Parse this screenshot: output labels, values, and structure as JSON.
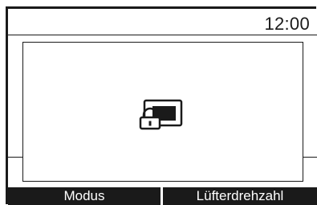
{
  "status_bar": {
    "time": "12:00"
  },
  "dialog": {
    "icon": "screen-lock-icon"
  },
  "softkeys": [
    {
      "label": "Modus"
    },
    {
      "label": "Lüfterdrehzahl"
    }
  ],
  "colors": {
    "foreground": "#1a1a1a",
    "background": "#ffffff",
    "softkey_text": "#ffffff"
  }
}
